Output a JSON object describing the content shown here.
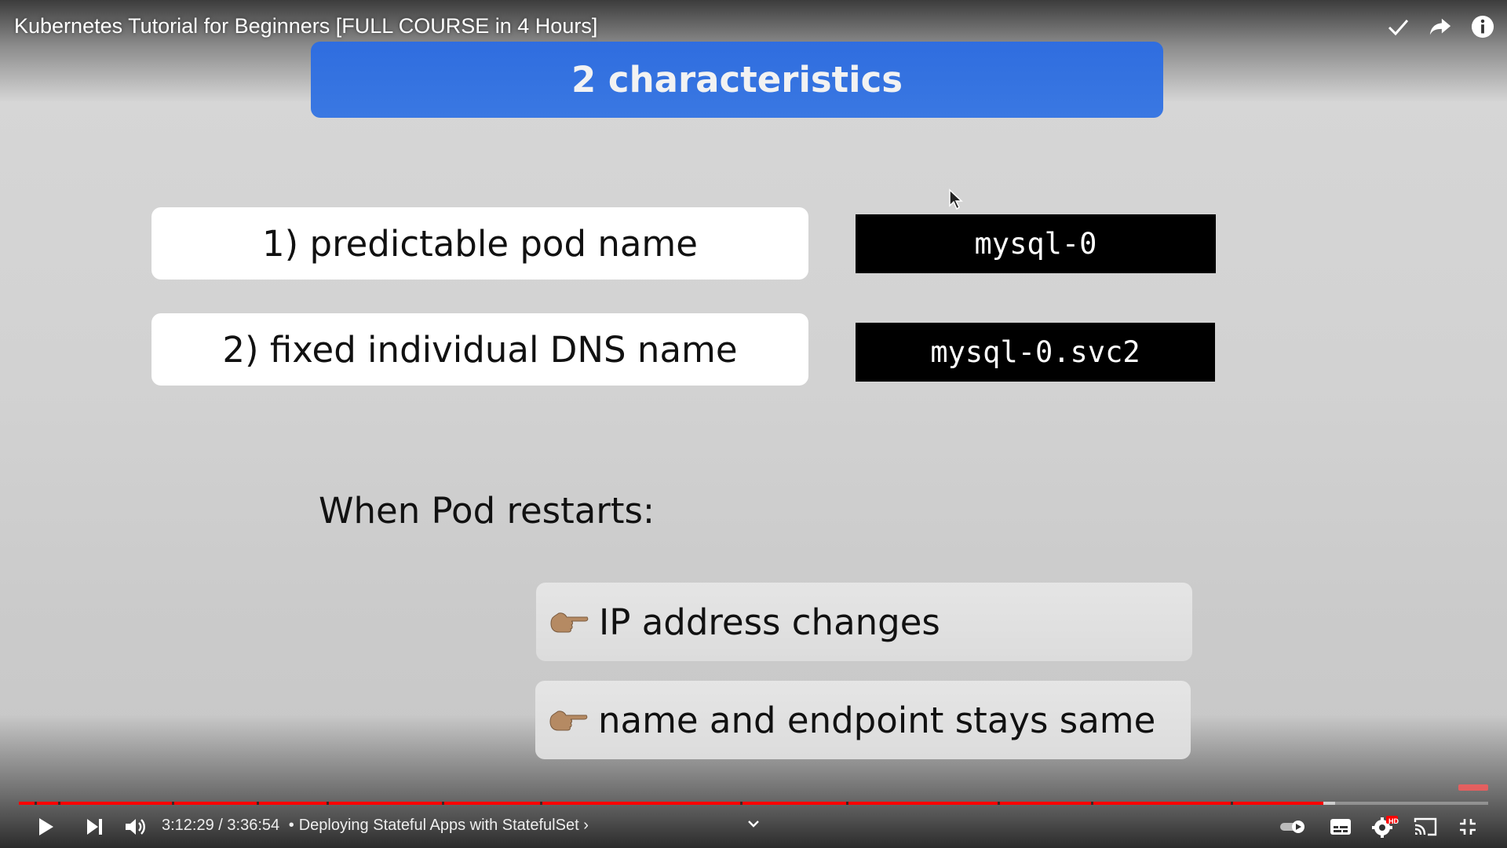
{
  "video": {
    "title": "Kubernetes Tutorial for Beginners [FULL COURSE in 4 Hours]",
    "current_time": "3:12:29",
    "duration": "3:36:54",
    "chapter": "Deploying Stateful Apps with StatefulSet",
    "time_separator": "/",
    "chapter_separator": "•",
    "chapter_arrow": "›",
    "progress_fraction": 0.888,
    "quality_badge": "HD"
  },
  "slide": {
    "header": "2 characteristics",
    "characteristics": [
      {
        "label": "1) predictable pod name",
        "code": "mysql-0"
      },
      {
        "label": "2) fixed individual DNS name",
        "code": "mysql-0.svc2"
      }
    ],
    "restart_heading": "When Pod restarts:",
    "bullets": [
      {
        "icon": "pointing-finger-icon",
        "text": "IP address changes"
      },
      {
        "icon": "pointing-finger-icon",
        "text": "name and endpoint stays same"
      }
    ]
  },
  "colors": {
    "header_blue": "#3274e0",
    "progress_red": "#ff0000",
    "code_bg": "#000000"
  },
  "icons": {
    "top": [
      "check-icon",
      "share-icon",
      "info-icon"
    ],
    "bottom_left": [
      "play-icon",
      "next-icon",
      "volume-icon"
    ],
    "bottom_right": [
      "autoplay-toggle-icon",
      "subtitles-icon",
      "settings-icon",
      "cast-icon",
      "exit-fullscreen-icon"
    ]
  }
}
